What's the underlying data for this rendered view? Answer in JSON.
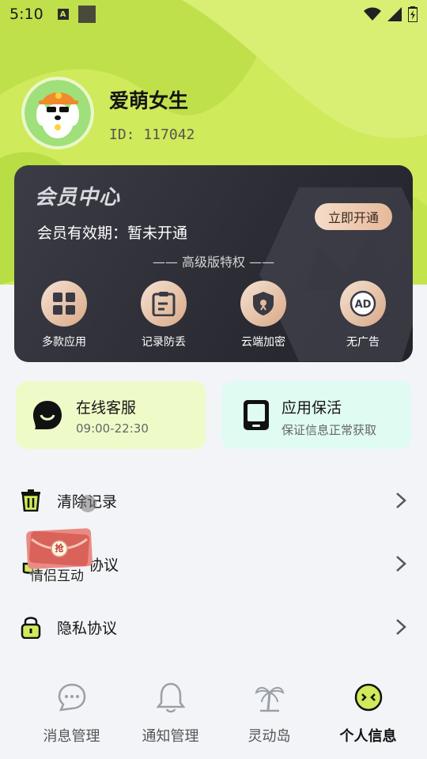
{
  "status_bar": {
    "time": "5:10",
    "notif_a": "A"
  },
  "profile": {
    "name": "爱萌女生",
    "id": "ID: 117042"
  },
  "vip": {
    "title": "会员中心",
    "expire": "会员有效期：暂未开通",
    "button": "立即开通",
    "subtitle": "—— 高级版特权 ——",
    "perks": [
      {
        "label": "多款应用",
        "icon": "apps-grid-icon"
      },
      {
        "label": "记录防丢",
        "icon": "clipboard-icon"
      },
      {
        "label": "云端加密",
        "icon": "shield-icon"
      },
      {
        "label": "无广告",
        "icon": "ad-block-icon"
      }
    ]
  },
  "cards": [
    {
      "title": "在线客服",
      "sub": "09:00-22:30",
      "bg": "#eefbc8",
      "icon": "chat-smile-icon"
    },
    {
      "title": "应用保活",
      "sub": "保证信息正常获取",
      "bg": "#dffbf2",
      "icon": "phone-icon"
    }
  ],
  "menu": [
    {
      "label": "清除记录",
      "icon": "trash-icon"
    },
    {
      "label": "协议",
      "icon": "hand-icon"
    },
    {
      "label": "隐私协议",
      "icon": "lock-icon"
    }
  ],
  "overlay": {
    "badge": "抢",
    "text": "情侣互动"
  },
  "tabs": [
    {
      "label": "消息管理",
      "icon": "message-icon"
    },
    {
      "label": "通知管理",
      "icon": "bell-icon"
    },
    {
      "label": "灵动岛",
      "icon": "palm-tree-icon"
    },
    {
      "label": "个人信息",
      "icon": "face-icon"
    }
  ],
  "colors": {
    "accent": "#cfea5a",
    "vip_bg": "#2f2f38",
    "gold": "#e6b99a"
  }
}
